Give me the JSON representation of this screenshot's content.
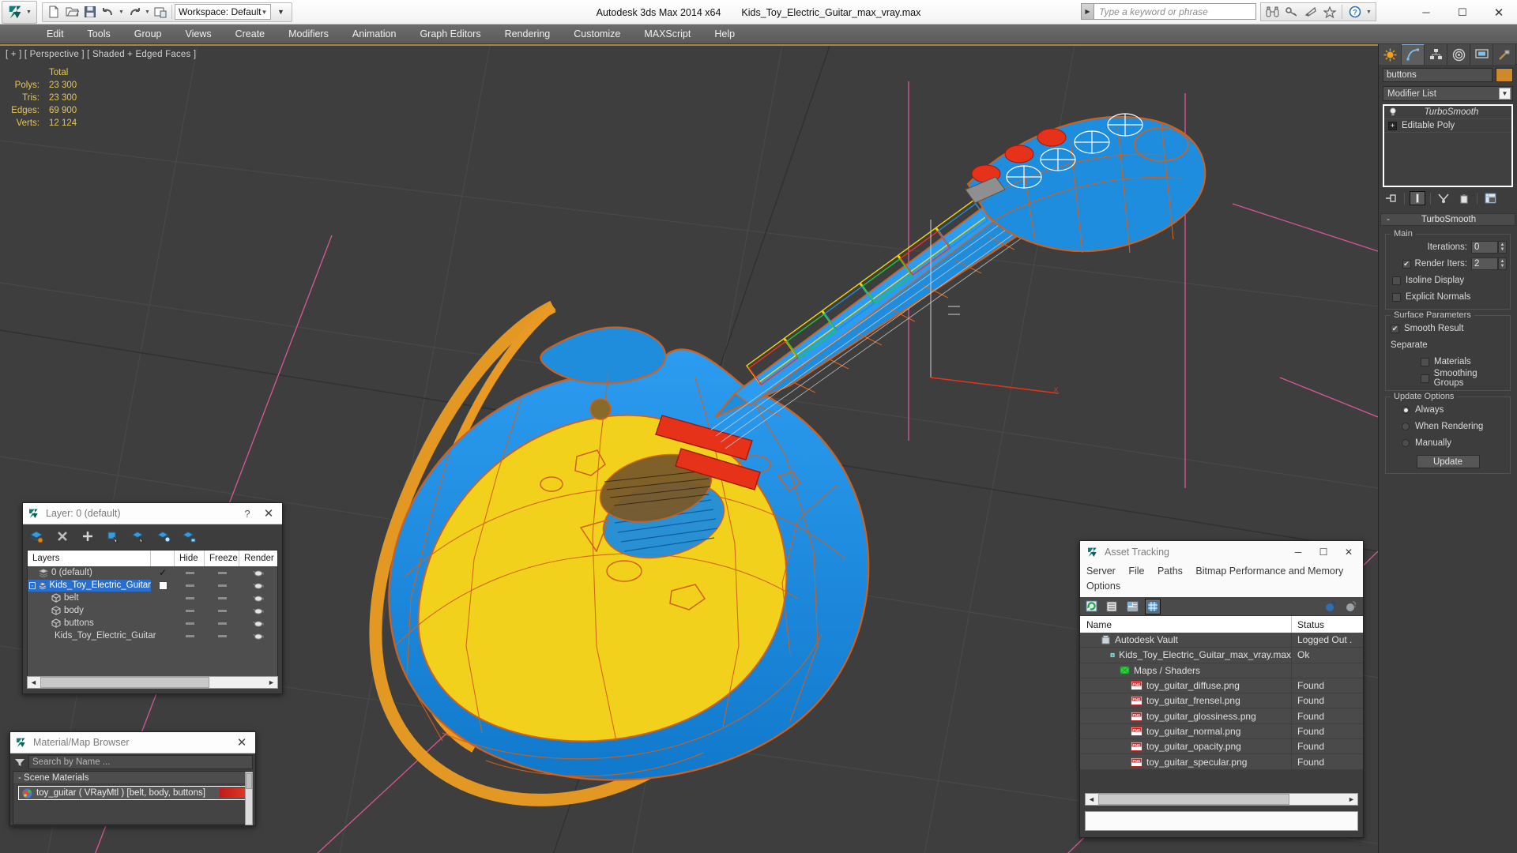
{
  "app": {
    "title": "Autodesk 3ds Max  2014 x64",
    "document": "Kids_Toy_Electric_Guitar_max_vray.max",
    "workspace": "Workspace: Default",
    "search_placeholder": "Type a keyword or phrase"
  },
  "menubar": {
    "items": [
      "Edit",
      "Tools",
      "Group",
      "Views",
      "Create",
      "Modifiers",
      "Animation",
      "Graph Editors",
      "Rendering",
      "Customize",
      "MAXScript",
      "Help"
    ]
  },
  "window_controls": {
    "minimize": "─",
    "maximize": "☐",
    "close": "✕"
  },
  "viewport": {
    "label": "[ + ] [ Perspective ] [ Shaded + Edged Faces ]",
    "stats": {
      "header": "Total",
      "rows": [
        {
          "label": "Polys:",
          "value": "23 300"
        },
        {
          "label": "Tris:",
          "value": "23 300"
        },
        {
          "label": "Edges:",
          "value": "69 900"
        },
        {
          "label": "Verts:",
          "value": "12 124"
        }
      ]
    }
  },
  "layer_dialog": {
    "title": "Layer: 0 (default)",
    "help": "?",
    "close": "✕",
    "columns": [
      "Layers",
      "",
      "Hide",
      "Freeze",
      "Render"
    ],
    "rows": [
      {
        "name": "0 (default)",
        "indent": 1,
        "icon": "layer-icon",
        "current": true,
        "selected": false
      },
      {
        "name": "Kids_Toy_Electric_Guitar",
        "indent": 0,
        "icon": "layer-icon",
        "current": false,
        "selected": true,
        "expander": "-"
      },
      {
        "name": "belt",
        "indent": 2,
        "icon": "object-icon",
        "current": false,
        "selected": false
      },
      {
        "name": "body",
        "indent": 2,
        "icon": "object-icon",
        "current": false,
        "selected": false
      },
      {
        "name": "buttons",
        "indent": 2,
        "icon": "object-icon",
        "current": false,
        "selected": false
      },
      {
        "name": "Kids_Toy_Electric_Guitar",
        "indent": 2,
        "icon": "object-icon",
        "current": false,
        "selected": false
      }
    ],
    "toolbar_icons": [
      "create-new-layer-icon",
      "delete-layer-icon",
      "add-layer-icon",
      "select-objects-in-layer-icon",
      "select-highlighted-objects-icon",
      "add-selection-to-layer-icon",
      "set-current-layer-icon"
    ]
  },
  "material_browser": {
    "title": "Material/Map Browser",
    "close": "✕",
    "search_placeholder": "Search by Name ...",
    "group": "- Scene Materials",
    "items": [
      {
        "name": "toy_guitar  ( VRayMtl )  [belt, body, buttons]",
        "swatch": "#d62420"
      }
    ]
  },
  "asset_tracking": {
    "title": "Asset Tracking",
    "minimize": "─",
    "maximize": "☐",
    "close": "✕",
    "menu": [
      "Server",
      "File",
      "Paths",
      "Bitmap Performance and Memory",
      "Options"
    ],
    "toolbar_icons": [
      "refresh-icon",
      "list-view-icon",
      "details-view-icon",
      "grid-view-icon",
      "vault-login-icon",
      "vault-logout-icon"
    ],
    "columns": [
      "Name",
      "Status"
    ],
    "rows": [
      {
        "name": "Autodesk Vault",
        "status": "Logged Out .",
        "indent": 1,
        "icon": "vault-icon"
      },
      {
        "name": "Kids_Toy_Electric_Guitar_max_vray.max",
        "status": "Ok",
        "indent": 2,
        "icon": "max-file-icon"
      },
      {
        "name": "Maps / Shaders",
        "status": "",
        "indent": 3,
        "icon": "maps-folder-icon"
      },
      {
        "name": "toy_guitar_diffuse.png",
        "status": "Found",
        "indent": 4,
        "icon": "png-icon"
      },
      {
        "name": "toy_guitar_frensel.png",
        "status": "Found",
        "indent": 4,
        "icon": "png-icon"
      },
      {
        "name": "toy_guitar_glossiness.png",
        "status": "Found",
        "indent": 4,
        "icon": "png-icon"
      },
      {
        "name": "toy_guitar_normal.png",
        "status": "Found",
        "indent": 4,
        "icon": "png-icon"
      },
      {
        "name": "toy_guitar_opacity.png",
        "status": "Found",
        "indent": 4,
        "icon": "png-icon"
      },
      {
        "name": "toy_guitar_specular.png",
        "status": "Found",
        "indent": 4,
        "icon": "png-icon"
      }
    ]
  },
  "command_panel": {
    "tabs": [
      "create-tab",
      "modify-tab",
      "hierarchy-tab",
      "motion-tab",
      "display-tab",
      "utilities-tab"
    ],
    "active_tab_index": 1,
    "object_name": "buttons",
    "object_color": "#cd8a2b",
    "modifier_list_label": "Modifier List",
    "stack": [
      {
        "name": "TurboSmooth",
        "italic": true,
        "selected": false,
        "icon": "lightbulb-icon"
      },
      {
        "name": "Editable Poly",
        "italic": false,
        "selected": false,
        "icon": "expand-plus-icon"
      }
    ],
    "stack_buttons": [
      "pin-stack-icon",
      "show-end-result-icon",
      "make-unique-icon",
      "remove-modifier-icon",
      "configure-modifier-sets-icon"
    ],
    "rollout": {
      "minus": "-",
      "title": "TurboSmooth",
      "main": {
        "title": "Main",
        "iterations_label": "Iterations:",
        "iterations_value": "0",
        "render_iters_label": "Render Iters:",
        "render_iters_value": "2",
        "render_iters_checked": true,
        "isoline_label": "Isoline Display",
        "isoline_checked": false,
        "explicit_label": "Explicit Normals",
        "explicit_checked": false
      },
      "surface": {
        "title": "Surface Parameters",
        "smooth_result_label": "Smooth Result",
        "smooth_result_checked": true,
        "separate_label": "Separate",
        "materials_label": "Materials",
        "materials_checked": false,
        "smoothing_groups_label": "Smoothing Groups",
        "smoothing_groups_checked": false
      },
      "update": {
        "title": "Update Options",
        "options": [
          "Always",
          "When Rendering",
          "Manually"
        ],
        "selected_index": 0,
        "button": "Update"
      }
    }
  },
  "colors": {
    "guitar_body_blue": "#1e8ddd",
    "guitar_face_yellow": "#f2d11c",
    "guitar_strap_orange": "#e89a24",
    "wire_orange": "#d2601a",
    "wire_red": "#e02b18",
    "viewport_bg": "#3e3e3e",
    "grid_pink": "#e0589a",
    "accent_blue": "#2a6ecc",
    "stats_yellow": "#e8c84a"
  }
}
